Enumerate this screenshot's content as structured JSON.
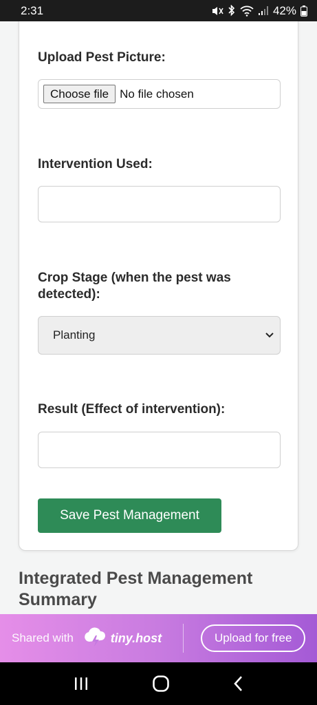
{
  "status_bar": {
    "time": "2:31",
    "battery": "42%"
  },
  "form": {
    "upload_label": "Upload Pest Picture:",
    "choose_file_label": "Choose file",
    "file_status": "No file chosen",
    "intervention_label": "Intervention Used:",
    "intervention_value": "",
    "crop_stage_label": "Crop Stage (when the pest was detected):",
    "crop_stage_selected": "Planting",
    "result_label": "Result (Effect of intervention):",
    "result_value": "",
    "save_label": "Save Pest Management"
  },
  "summary": {
    "title": "Integrated Pest Management Summary"
  },
  "promo": {
    "shared_label": "Shared with",
    "brand": "tiny.host",
    "upload_label": "Upload for free"
  },
  "colors": {
    "primary_button": "#2e8b57",
    "promo_gradient_start": "#e58ee8",
    "promo_gradient_end": "#a45ad6"
  },
  "icons": [
    "mute-icon",
    "bluetooth-icon",
    "wifi-icon",
    "signal-icon",
    "battery-icon",
    "chevron-down-icon",
    "lightning-cloud-icon",
    "recents-icon",
    "home-icon",
    "back-icon"
  ]
}
